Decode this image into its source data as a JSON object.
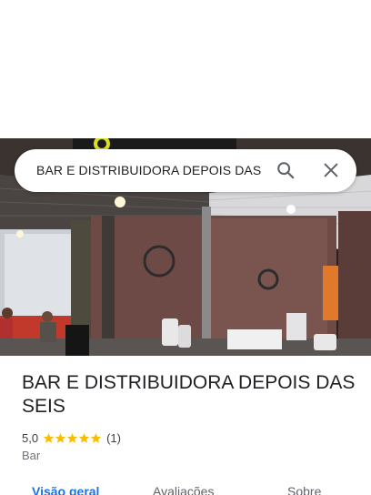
{
  "search": {
    "query": "BAR E DISTRIBUIDORA DEPOIS DAS"
  },
  "place": {
    "name": "BAR E DISTRIBUIDORA DEPOIS DAS SEIS",
    "rating": "5,0",
    "stars": 5,
    "reviews_count": "(1)",
    "category": "Bar"
  },
  "tabs": [
    {
      "label": "Visão geral",
      "active": true
    },
    {
      "label": "Avaliações",
      "active": false
    },
    {
      "label": "Sobre",
      "active": false
    }
  ],
  "hero_photo": {
    "description_icon": "photo-of-bar-interior"
  },
  "colors": {
    "accent": "#1a73e8",
    "star": "#fbbc04",
    "title": "#202124",
    "muted": "#70757a"
  }
}
